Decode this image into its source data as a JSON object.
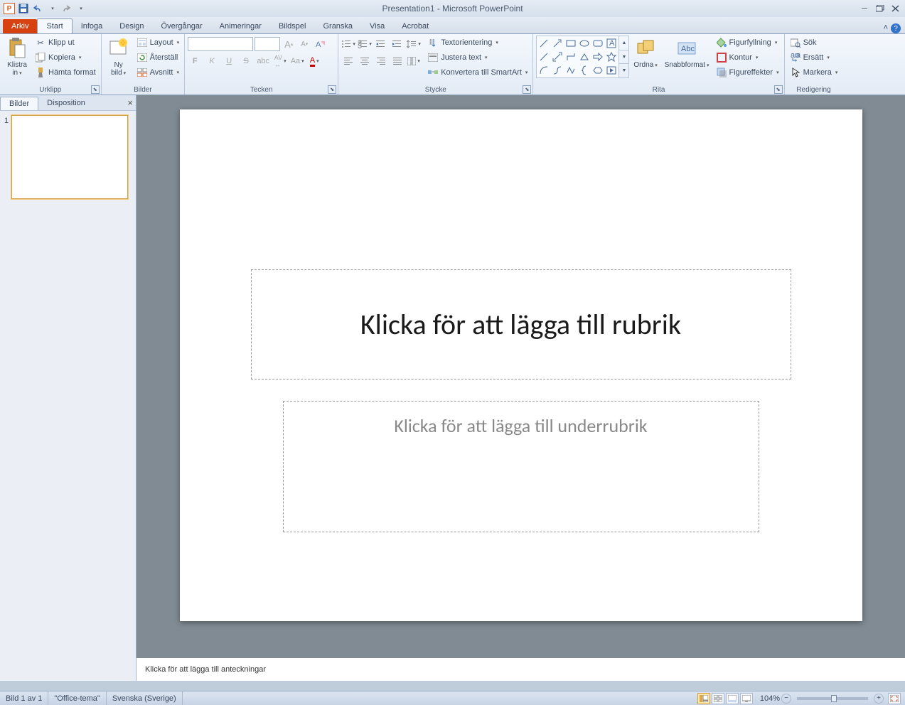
{
  "title": "Presentation1 - Microsoft PowerPoint",
  "tabs": {
    "file": "Arkiv",
    "home": "Start",
    "insert": "Infoga",
    "design": "Design",
    "transitions": "Övergångar",
    "animations": "Animeringar",
    "slideshow": "Bildspel",
    "review": "Granska",
    "view": "Visa",
    "acrobat": "Acrobat"
  },
  "groups": {
    "clipboard": "Urklipp",
    "slides": "Bilder",
    "font": "Tecken",
    "paragraph": "Stycke",
    "drawing": "Rita",
    "editing": "Redigering"
  },
  "clipboard": {
    "paste": "Klistra\nin",
    "cut": "Klipp ut",
    "copy": "Kopiera",
    "format_painter": "Hämta format"
  },
  "slides": {
    "new_slide": "Ny\nbild",
    "layout": "Layout",
    "reset": "Återställ",
    "section": "Avsnitt"
  },
  "paragraph": {
    "text_direction": "Textorientering",
    "align_text": "Justera text",
    "convert_smartart": "Konvertera till SmartArt"
  },
  "drawing": {
    "arrange": "Ordna",
    "quick_styles": "Snabbformat",
    "shape_fill": "Figurfyllning",
    "shape_outline": "Kontur",
    "shape_effects": "Figureffekter"
  },
  "editing": {
    "find": "Sök",
    "replace": "Ersätt",
    "select": "Markera"
  },
  "panel": {
    "slides_tab": "Bilder",
    "outline_tab": "Disposition"
  },
  "slide": {
    "title_placeholder": "Klicka för att lägga till rubrik",
    "subtitle_placeholder": "Klicka för att lägga till underrubrik",
    "number": "1"
  },
  "notes": {
    "placeholder": "Klicka för att lägga till anteckningar"
  },
  "status": {
    "slide_count": "Bild 1 av 1",
    "theme": "\"Office-tema\"",
    "language": "Svenska (Sverige)",
    "zoom": "104%"
  }
}
